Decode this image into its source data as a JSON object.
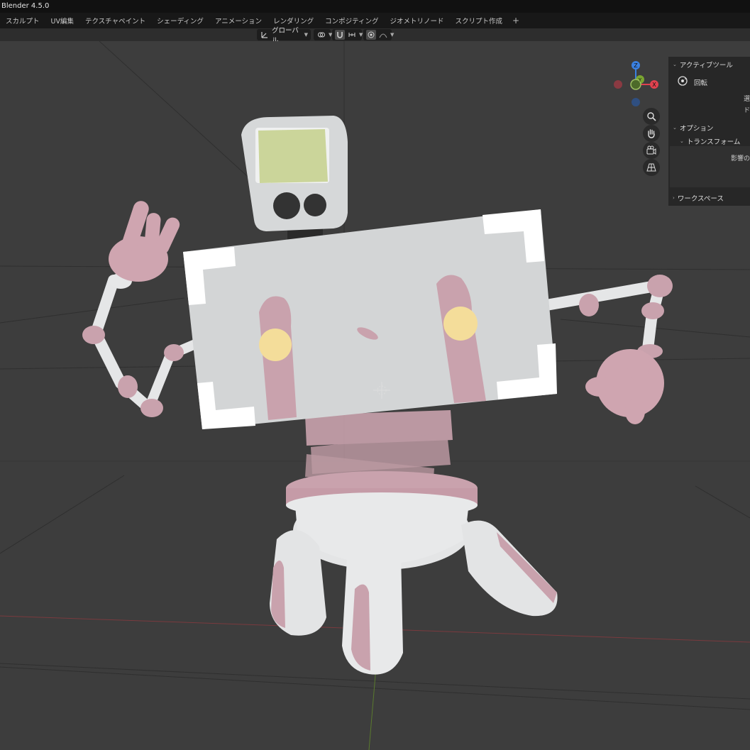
{
  "app": {
    "title": "Blender 4.5.0"
  },
  "workspace_tabs": [
    "スカルプト",
    "UV編集",
    "テクスチャペイント",
    "シェーディング",
    "アニメーション",
    "レンダリング",
    "コンポジティング",
    "ジオメトリノード",
    "スクリプト作成"
  ],
  "workspace_add": "+",
  "header": {
    "transform_orientation": "グローバル",
    "transform_orientation_icon": "orientation-axes-icon",
    "pivot_icon": "pivot-icon",
    "snap_icon": "snap-magnet-icon",
    "snap_target_icon": "snap-increment-icon",
    "proportional_icon": "proportional-edit-icon",
    "falloff_icon": "falloff-curve-icon"
  },
  "gizmo": {
    "x_label": "X",
    "y_label": "Y",
    "z_label": "Z",
    "colors": {
      "x": "#e0424f",
      "y": "#7aa531",
      "z": "#3a80e0",
      "neg_x": "#8a3a42",
      "neg_y": "#4d6a2a",
      "neg_z": "#2f4f80"
    }
  },
  "nav_tools": [
    "zoom-icon",
    "pan-hand-icon",
    "camera-icon",
    "ortho-grid-icon"
  ],
  "npanel": {
    "active_tool_header": "アクティブツール",
    "tool_name": "回転",
    "tool_icon": "rotate-icon",
    "clipped_1": "選",
    "clipped_2": "ド",
    "options_header": "オプション",
    "transform_header": "トランスフォーム",
    "clipped_3": "影響の",
    "workspace_header": "ワークスペース"
  },
  "scene": {
    "body_color": "#d3d5d6",
    "pink_color": "#c9a2ad",
    "screen_color": "#cbd59a",
    "yellow_color": "#f4dd9a",
    "bg_color": "#3d3d3d"
  }
}
